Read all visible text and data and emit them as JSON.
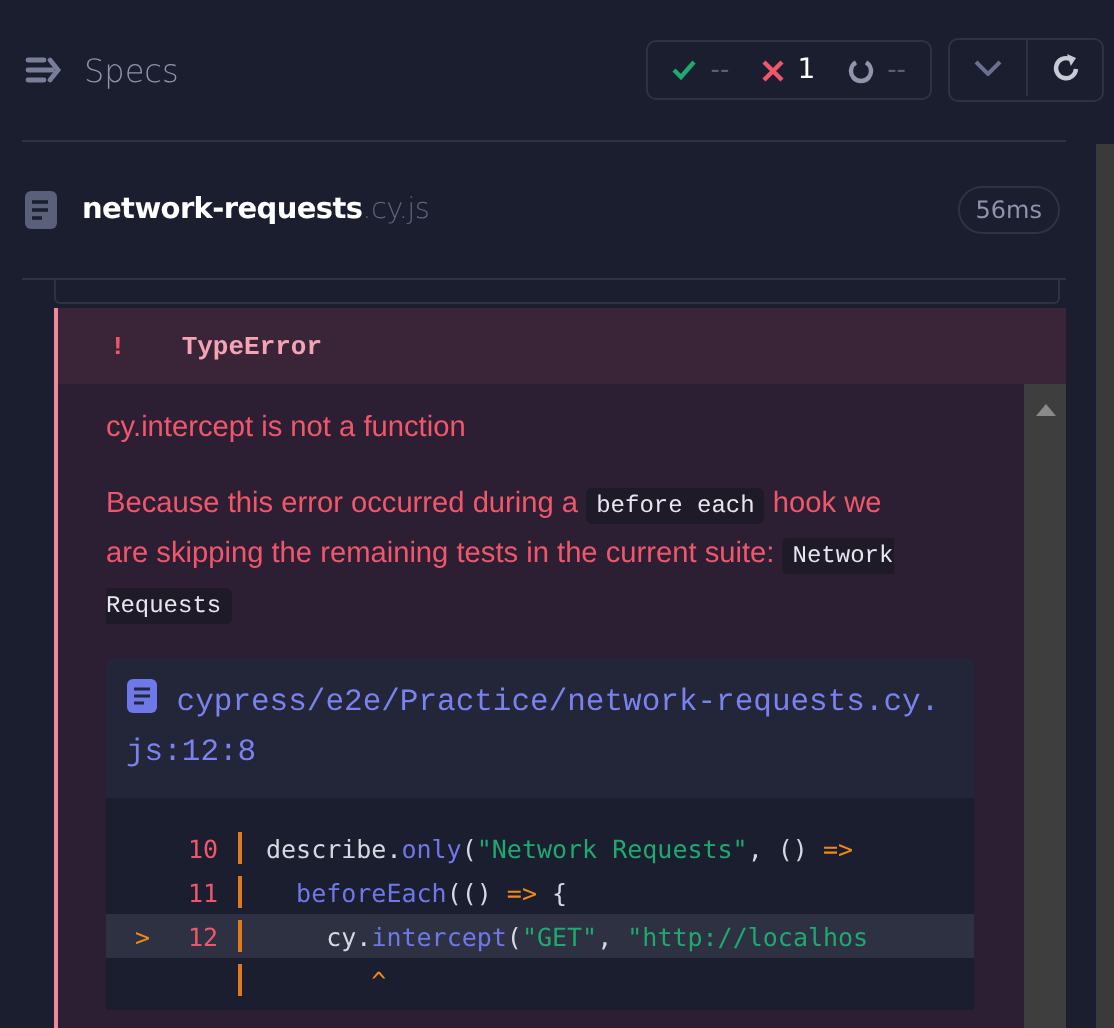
{
  "header": {
    "title": "Specs",
    "stats": [
      {
        "kind": "passed",
        "value": "--"
      },
      {
        "kind": "failed",
        "value": "1"
      },
      {
        "kind": "pending",
        "value": "--"
      }
    ]
  },
  "spec": {
    "name": "network-requests",
    "extension": ".cy.js",
    "duration": "56ms"
  },
  "error": {
    "bang": "!",
    "type": "TypeError",
    "message": "cy.intercept is not a function",
    "detail": "Because this error occurred during a",
    "detail_code": "before each",
    "detail_rest": "hook we are skipping the remaining tests in the current suite:",
    "suite_code": "Network Requests",
    "file": "cypress/e2e/Practice/network-requests.cy.js:12:8",
    "code_lines": [
      {
        "number": "10",
        "current": false,
        "tokens": [
          {
            "kind": "plain",
            "text": "describe."
          },
          {
            "kind": "fn",
            "text": "only"
          },
          {
            "kind": "plain",
            "text": "("
          },
          {
            "kind": "str",
            "text": "\"Network Requests\""
          },
          {
            "kind": "plain",
            "text": ", () "
          },
          {
            "kind": "op",
            "text": "=>"
          }
        ]
      },
      {
        "number": "11",
        "current": false,
        "tokens": [
          {
            "kind": "fn",
            "text": "  beforeEach"
          },
          {
            "kind": "plain",
            "text": "(() "
          },
          {
            "kind": "op",
            "text": "=>"
          },
          {
            "kind": "plain",
            "text": " {"
          }
        ]
      },
      {
        "number": "12",
        "current": true,
        "marker": ">",
        "tokens": [
          {
            "kind": "plain",
            "text": "    cy."
          },
          {
            "kind": "fn",
            "text": "intercept"
          },
          {
            "kind": "plain",
            "text": "("
          },
          {
            "kind": "str",
            "text": "\"GET\""
          },
          {
            "kind": "plain",
            "text": ", "
          },
          {
            "kind": "str",
            "text": "\"http://localhos"
          }
        ]
      },
      {
        "current": false,
        "tokens": [
          {
            "kind": "op",
            "text": "       ^"
          }
        ]
      }
    ]
  }
}
